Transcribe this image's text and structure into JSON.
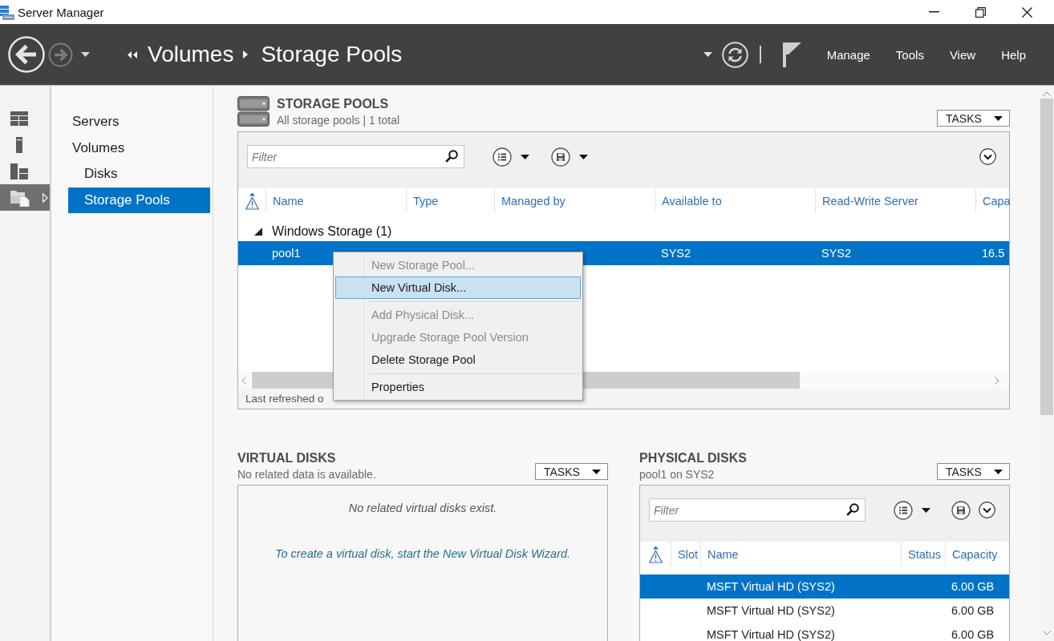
{
  "window": {
    "title": "Server Manager"
  },
  "header": {
    "nav_buttons": [
      {
        "kind": "back",
        "disabled": false
      },
      {
        "kind": "forward",
        "disabled": true
      }
    ],
    "breadcrumb": [
      "Volumes",
      "Storage Pools"
    ],
    "menu": [
      "Manage",
      "Tools",
      "View",
      "Help"
    ]
  },
  "rail": [
    {
      "kind": "dashboard",
      "selected": false
    },
    {
      "kind": "local_server",
      "selected": false
    },
    {
      "kind": "all_servers",
      "selected": false
    },
    {
      "kind": "file_storage",
      "selected": true
    }
  ],
  "nav": [
    {
      "label": "Servers",
      "selected": false
    },
    {
      "label": "Volumes",
      "selected": false,
      "children": [
        {
          "label": "Disks",
          "selected": false
        },
        {
          "label": "Storage Pools",
          "selected": true
        }
      ]
    }
  ],
  "storage_pools": {
    "title": "STORAGE POOLS",
    "subtitle": "All storage pools | 1 total",
    "tasks": "TASKS",
    "filter": {
      "placeholder": "Filter"
    },
    "columns": [
      "Name",
      "Type",
      "Managed by",
      "Available to",
      "Read-Write Server",
      "Capa"
    ],
    "groups": [
      {
        "label": "Windows Storage (1)",
        "expanded": true,
        "rows": [
          {
            "selected": true,
            "name": "pool1",
            "available_to": "SYS2",
            "read_write_server": "SYS2",
            "column_6": "16.5"
          }
        ]
      }
    ],
    "footer": "Last refreshed o"
  },
  "context_menu": {
    "items": [
      {
        "kind": "item",
        "label": "New Storage Pool...",
        "disabled": true,
        "highlighted": false
      },
      {
        "kind": "item",
        "label": "New Virtual Disk...",
        "disabled": false,
        "highlighted": true
      },
      {
        "kind": "separator"
      },
      {
        "kind": "item",
        "label": "Add Physical Disk...",
        "disabled": true,
        "highlighted": false
      },
      {
        "kind": "item",
        "label": "Upgrade Storage Pool Version",
        "disabled": true,
        "highlighted": false
      },
      {
        "kind": "item",
        "label": "Delete Storage Pool",
        "disabled": false,
        "highlighted": false
      },
      {
        "kind": "separator"
      },
      {
        "kind": "item",
        "label": "Properties",
        "disabled": false,
        "highlighted": false
      }
    ]
  },
  "virtual_disks": {
    "title": "VIRTUAL DISKS",
    "subtitle": "No related data is available.",
    "tasks": "TASKS",
    "empty_message": "No related virtual disks exist.",
    "wizard_link": "To create a virtual disk, start the New Virtual Disk Wizard."
  },
  "physical_disks": {
    "title": "PHYSICAL DISKS",
    "subtitle": "pool1 on SYS2",
    "tasks": "TASKS",
    "filter": {
      "placeholder": "Filter"
    },
    "columns": [
      "Slot",
      "Name",
      "Status",
      "Capacity"
    ],
    "rows": [
      {
        "selected": true,
        "name": "MSFT Virtual HD (SYS2)",
        "capacity": "6.00 GB"
      },
      {
        "selected": false,
        "name": "MSFT Virtual HD (SYS2)",
        "capacity": "6.00 GB"
      },
      {
        "selected": false,
        "name": "MSFT Virtual HD (SYS2)",
        "capacity": "6.00 GB"
      }
    ]
  }
}
